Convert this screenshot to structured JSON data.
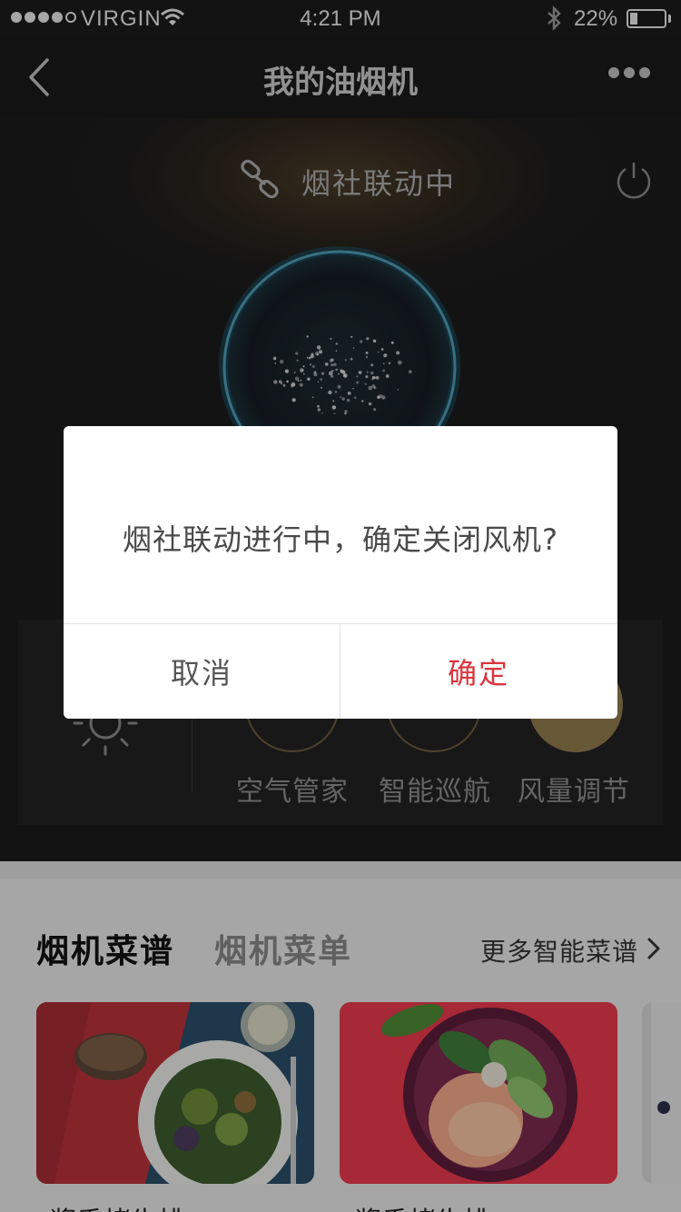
{
  "status_bar": {
    "carrier": "VIRGIN",
    "time": "4:21 PM",
    "battery_percent": "22%",
    "battery_level": 0.22,
    "signal_bars_filled": 4,
    "signal_bars_total": 5
  },
  "nav": {
    "title": "我的油烟机",
    "back_icon": "chevron-left-icon",
    "more_icon": "more-dots-icon"
  },
  "hood": {
    "link_status": "烟社联动中",
    "link_icon": "chain-link-icon",
    "power_icon": "power-icon"
  },
  "controls": {
    "light_icon": "sun-icon",
    "modes": [
      {
        "label": "空气管家",
        "active": false
      },
      {
        "label": "智能巡航",
        "active": false
      },
      {
        "label": "风量调节",
        "active": true
      }
    ],
    "accent": "#8f7a4e"
  },
  "recipes": {
    "tabs": [
      "烟机菜谱",
      "烟机菜单"
    ],
    "active_tab": 0,
    "more_label": "更多智能菜谱",
    "cards": [
      {
        "name": "酱香烤牛排"
      },
      {
        "name": "酱香烤牛排"
      },
      {
        "name": ""
      }
    ]
  },
  "dialog": {
    "message": "烟社联动进行中，确定关闭风机?",
    "cancel_label": "取消",
    "confirm_label": "确定",
    "confirm_color": "#d9363e"
  }
}
